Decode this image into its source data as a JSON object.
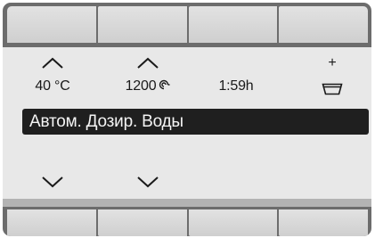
{
  "display": {
    "temperature": "40 °C",
    "spin_speed": "1200",
    "duration": "1:59h",
    "dose_plus": "+",
    "program_bar": "Автом. Дозир. Воды"
  },
  "icons": {
    "temperature_up": "chevron-up-icon",
    "temperature_down": "chevron-down-icon",
    "spin_up": "chevron-up-icon",
    "spin_down": "chevron-down-icon",
    "spin_symbol": "spin-icon",
    "detergent_tray": "detergent-tray-icon"
  },
  "colors": {
    "frame": "#6c6c6c",
    "key": "#d9d9d9",
    "screen": "#e8e8e8",
    "bar": "#1f1f1f",
    "bar_text": "#f4f4f4"
  }
}
